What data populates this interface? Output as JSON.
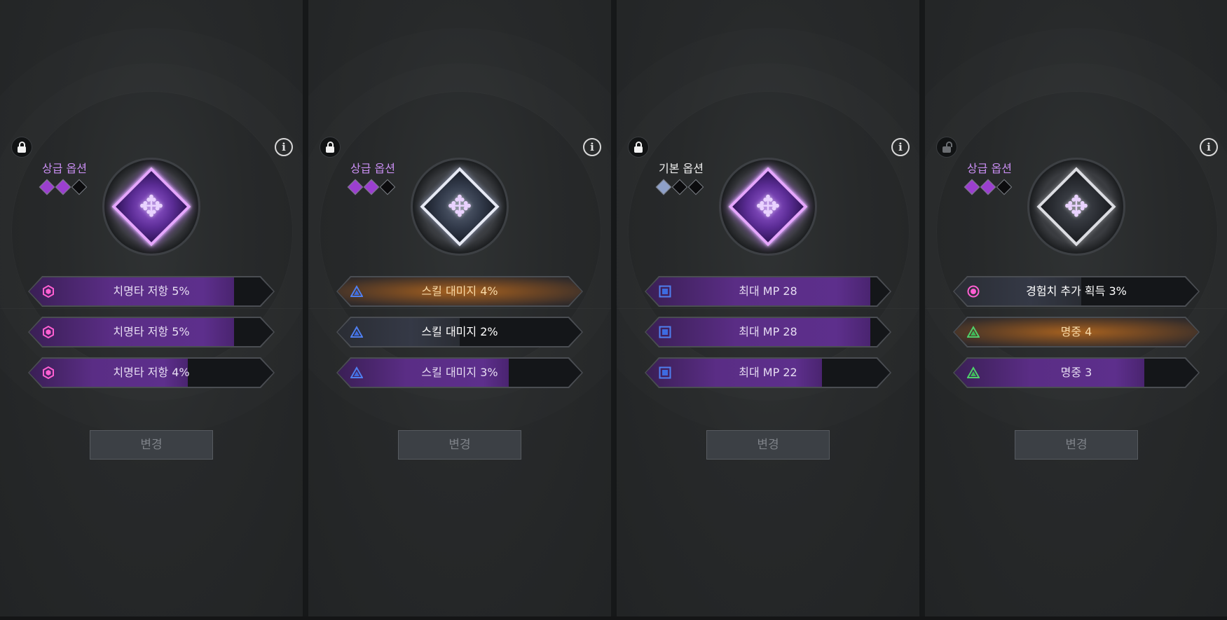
{
  "colors": {
    "purple_label": "#c98ef2",
    "white_label": "#f0f0f0",
    "purple_pip": "#9b3fcf",
    "silver_pip": "#8ea0c8"
  },
  "panels": [
    {
      "grade_label": "상급 옵션",
      "grade": "purple",
      "locked": true,
      "gem": "purple",
      "pips": [
        "purple",
        "purple",
        "black"
      ],
      "options": [
        {
          "text": "치명타 저항 5%",
          "icon": "hexagon-pink-icon",
          "style": "purple",
          "fill": 0.84
        },
        {
          "text": "치명타 저항 5%",
          "icon": "hexagon-pink-icon",
          "style": "purple",
          "fill": 0.84
        },
        {
          "text": "치명타 저항 4%",
          "icon": "hexagon-pink-icon",
          "style": "purple",
          "fill": 0.65
        }
      ],
      "change_label": "변경"
    },
    {
      "grade_label": "상급 옵션",
      "grade": "purple",
      "locked": true,
      "gem": "silver",
      "pips": [
        "purple",
        "purple",
        "black"
      ],
      "options": [
        {
          "text": "스킬 대미지 4%",
          "icon": "triangle-blue-icon",
          "style": "orange",
          "fill": 1.0
        },
        {
          "text": "스킬 대미지 2%",
          "icon": "triangle-blue-icon",
          "style": "white",
          "fill": 0.5
        },
        {
          "text": "스킬 대미지 3%",
          "icon": "triangle-blue-icon",
          "style": "purple",
          "fill": 0.7
        }
      ],
      "change_label": "변경"
    },
    {
      "grade_label": "기본 옵션",
      "grade": "white",
      "locked": true,
      "gem": "purple",
      "pips": [
        "silver",
        "black",
        "black"
      ],
      "options": [
        {
          "text": "최대 MP 28",
          "icon": "square-blue-icon",
          "style": "purple",
          "fill": 0.92
        },
        {
          "text": "최대 MP 28",
          "icon": "square-blue-icon",
          "style": "purple",
          "fill": 0.92
        },
        {
          "text": "최대 MP 22",
          "icon": "square-blue-icon",
          "style": "purple",
          "fill": 0.72
        }
      ],
      "change_label": "변경"
    },
    {
      "grade_label": "상급 옵션",
      "grade": "purple",
      "locked": false,
      "gem": "dark",
      "pips": [
        "purple",
        "purple",
        "black"
      ],
      "options": [
        {
          "text": "경험치 추가 획득 3%",
          "icon": "circle-pink-icon",
          "style": "white",
          "fill": 0.52
        },
        {
          "text": "명중 4",
          "icon": "triangle-green-icon",
          "style": "orange",
          "fill": 1.0
        },
        {
          "text": "명중 3",
          "icon": "triangle-green-icon",
          "style": "purple",
          "fill": 0.78
        }
      ],
      "change_label": "변경"
    }
  ]
}
